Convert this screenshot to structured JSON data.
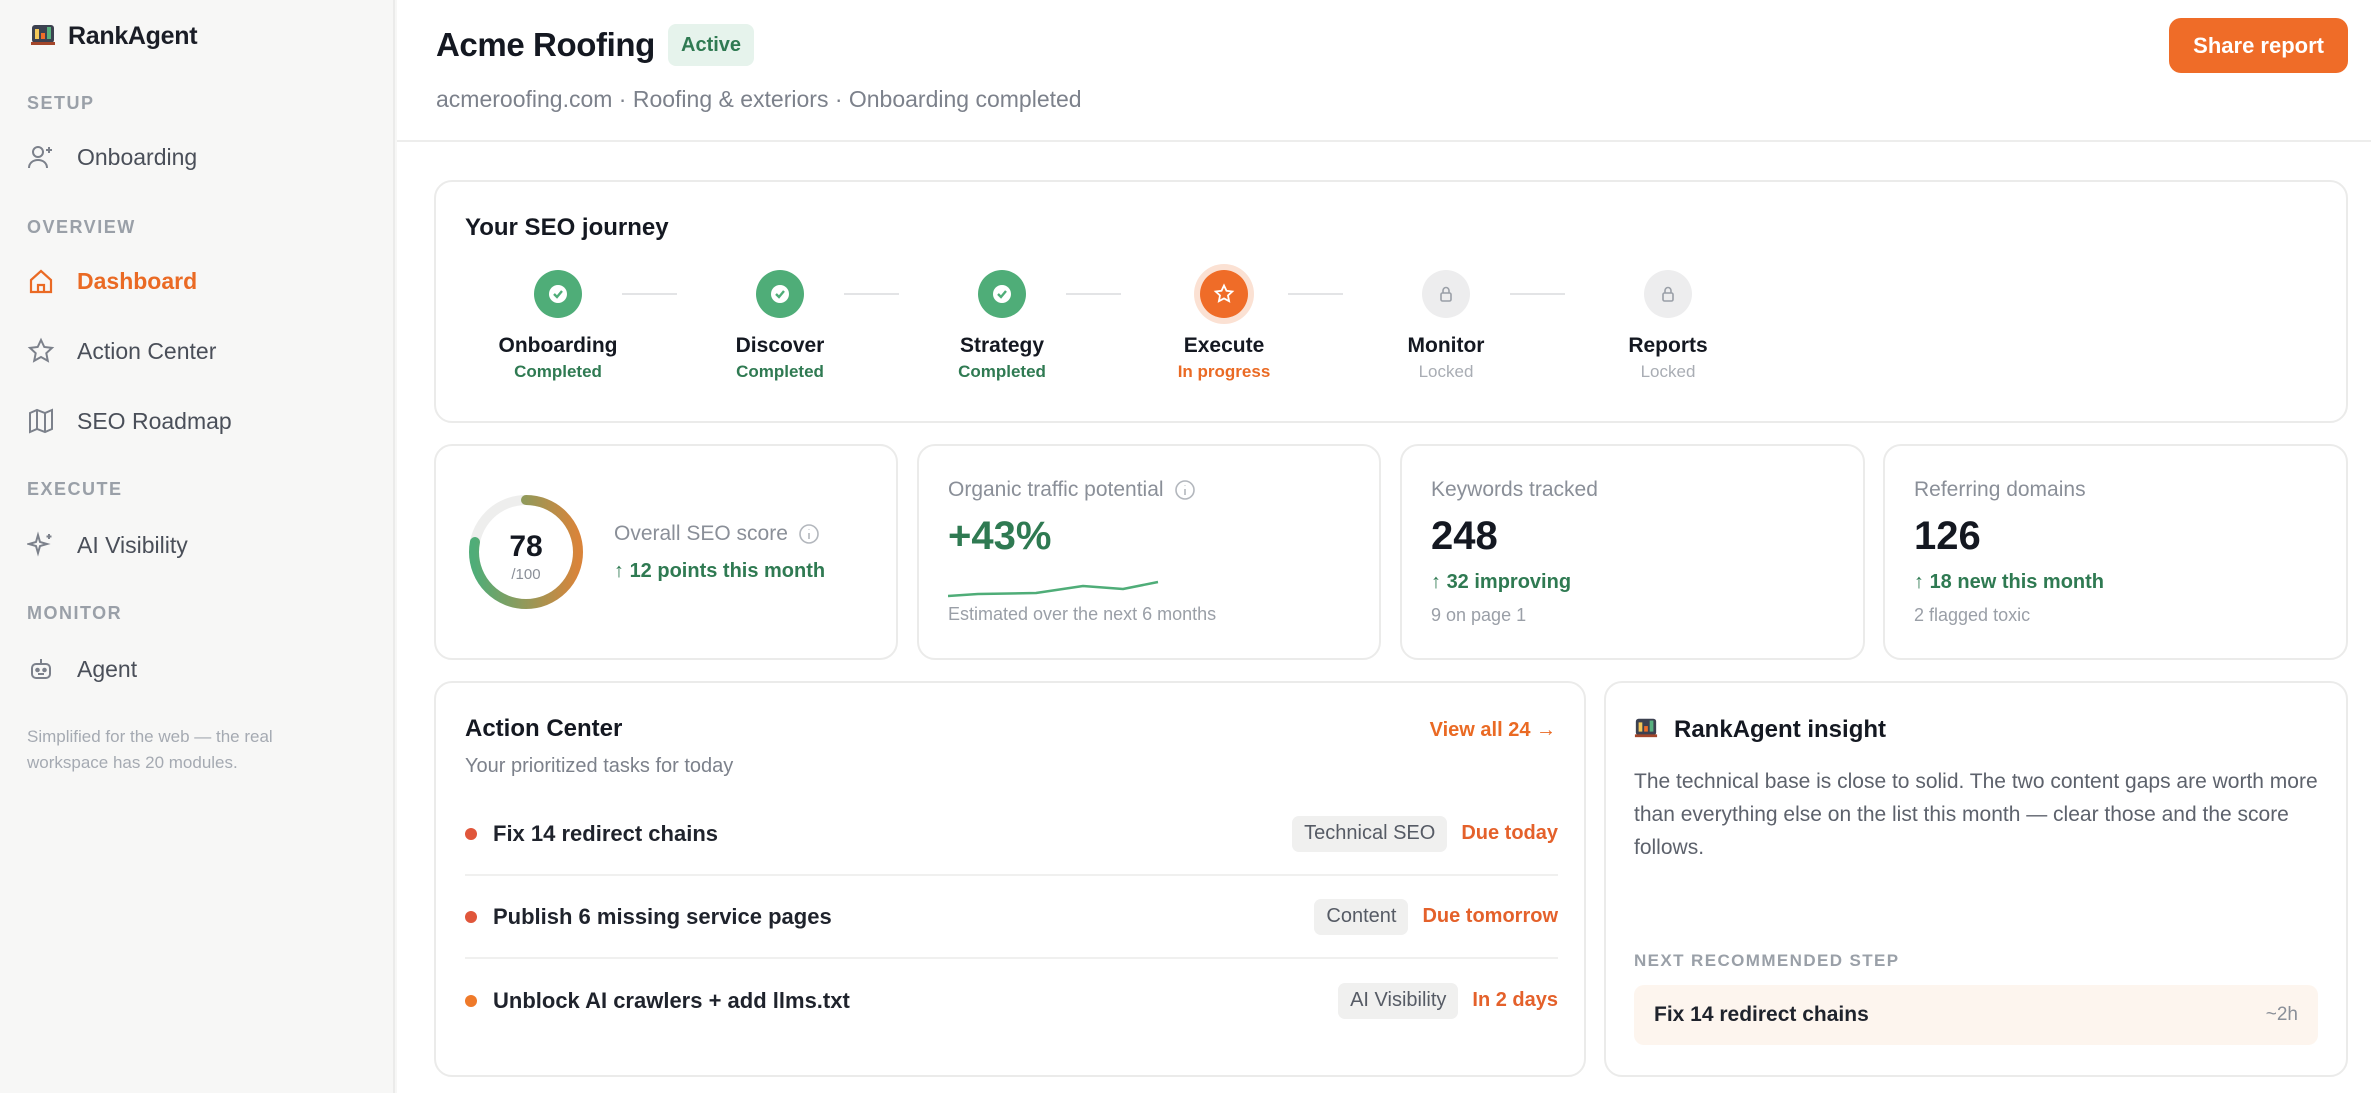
{
  "brand": {
    "name": "RankAgent"
  },
  "sidebar": {
    "sections": [
      {
        "label": "SETUP",
        "items": [
          {
            "label": "Onboarding",
            "icon": "user-plus-icon"
          }
        ]
      },
      {
        "label": "OVERVIEW",
        "items": [
          {
            "label": "Dashboard",
            "icon": "home-icon",
            "active": true
          },
          {
            "label": "Action Center",
            "icon": "star-icon"
          },
          {
            "label": "SEO Roadmap",
            "icon": "map-icon"
          }
        ]
      },
      {
        "label": "EXECUTE",
        "items": [
          {
            "label": "AI Visibility",
            "icon": "sparkle-icon"
          }
        ]
      },
      {
        "label": "MONITOR",
        "items": [
          {
            "label": "Agent",
            "icon": "robot-icon"
          }
        ]
      }
    ],
    "note": "Simplified for the web — the real workspace has 20 modules."
  },
  "header": {
    "title": "Acme Roofing",
    "status": "Active",
    "subtitle": "acmeroofing.com · Roofing & exteriors · Onboarding completed",
    "share_label": "Share report"
  },
  "journey": {
    "title": "Your SEO journey",
    "steps": [
      {
        "name": "Onboarding",
        "state": "Completed",
        "status": "done"
      },
      {
        "name": "Discover",
        "state": "Completed",
        "status": "done"
      },
      {
        "name": "Strategy",
        "state": "Completed",
        "status": "done"
      },
      {
        "name": "Execute",
        "state": "In progress",
        "status": "current"
      },
      {
        "name": "Monitor",
        "state": "Locked",
        "status": "locked"
      },
      {
        "name": "Reports",
        "state": "Locked",
        "status": "locked"
      }
    ]
  },
  "stats": {
    "score": {
      "value": "78",
      "max": "/100",
      "fraction": 0.78,
      "label": "Overall SEO score",
      "trend": "12 points this month"
    },
    "traffic": {
      "label": "Organic traffic potential",
      "value": "+43%",
      "foot": "Estimated over the next 6 months"
    },
    "keywords": {
      "label": "Keywords tracked",
      "value": "248",
      "trend": "32 improving",
      "foot": "9 on page 1"
    },
    "domains": {
      "label": "Referring domains",
      "value": "126",
      "trend": "18 new this month",
      "foot": "2 flagged toxic"
    }
  },
  "action_center": {
    "title": "Action Center",
    "view_all": "View all 24 →",
    "subtitle": "Your prioritized tasks for today",
    "tasks": [
      {
        "name": "Fix 14 redirect chains",
        "tag": "Technical SEO",
        "due": "Due today",
        "dot_color": "#e0563b"
      },
      {
        "name": "Publish 6 missing service pages",
        "tag": "Content",
        "due": "Due tomorrow",
        "dot_color": "#e0563b"
      },
      {
        "name": "Unblock AI crawlers + add llms.txt",
        "tag": "AI Visibility",
        "due": "In 2 days",
        "dot_color": "#ef7a2a"
      }
    ]
  },
  "insight": {
    "title": "RankAgent insight",
    "body": "The technical base is close to solid. The two content gaps are worth more than everything else on the list this month — clear those and the score follows.",
    "next_label": "NEXT RECOMMENDED STEP",
    "next_step": "Fix 14 redirect chains",
    "next_estimate": "~2h"
  },
  "colors": {
    "accent": "#ef6c28",
    "success": "#2f7a52",
    "success_fill": "#4fad78"
  }
}
